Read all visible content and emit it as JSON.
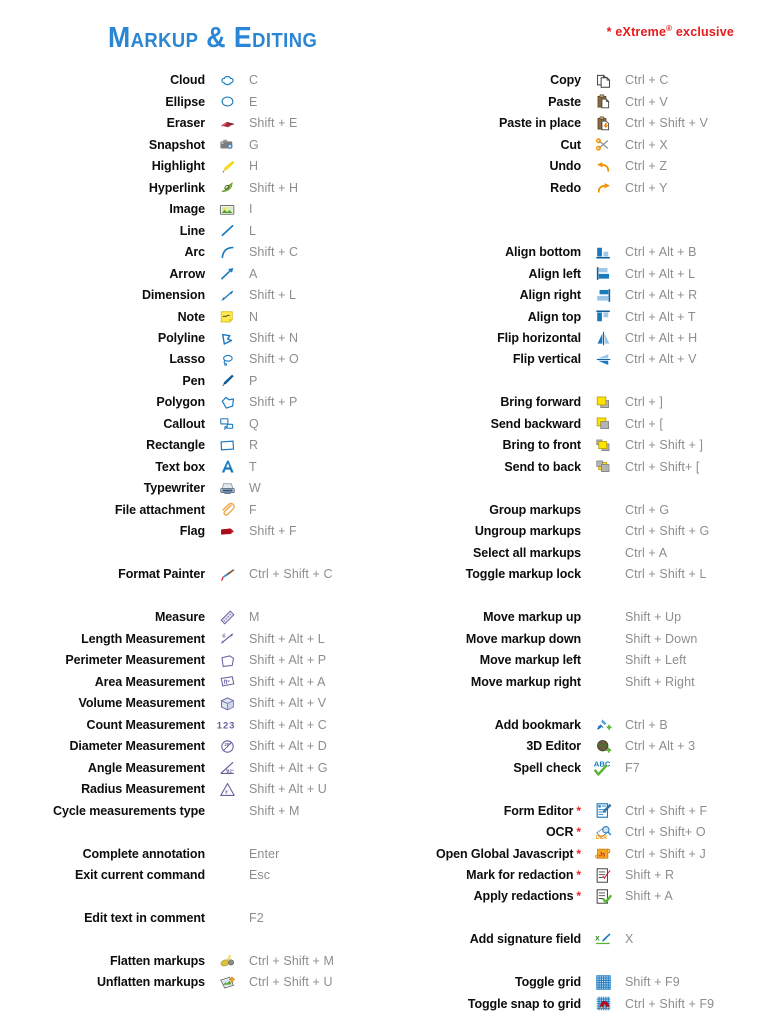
{
  "header": {
    "title": "Markup & Editing",
    "exclusive_note": "* eXtreme® exclusive",
    "colors": {
      "title_blue": "#2a86d4",
      "exclusive_red": "#e8191b",
      "label_black": "#0d0d0d",
      "shortcut_gray": "#8d8d8d",
      "measure_purple": "#6b5e9e",
      "markup_blue": "#1a7ac0",
      "page_background": "#ffffff"
    }
  },
  "left_column": [
    {
      "label": "Cloud",
      "icon": "cloud-icon",
      "shortcut": "C"
    },
    {
      "label": "Ellipse",
      "icon": "ellipse-icon",
      "shortcut": "E"
    },
    {
      "label": "Eraser",
      "icon": "eraser-icon",
      "shortcut": "Shift + E"
    },
    {
      "label": "Snapshot",
      "icon": "camera-icon",
      "shortcut": "G"
    },
    {
      "label": "Highlight",
      "icon": "highlighter-icon",
      "shortcut": "H"
    },
    {
      "label": "Hyperlink",
      "icon": "hyperlink-icon",
      "shortcut": "Shift + H"
    },
    {
      "label": "Image",
      "icon": "image-icon",
      "shortcut": "I"
    },
    {
      "label": "Line",
      "icon": "line-icon",
      "shortcut": "L"
    },
    {
      "label": "Arc",
      "icon": "arc-icon",
      "shortcut": "Shift + C"
    },
    {
      "label": "Arrow",
      "icon": "arrow-icon",
      "shortcut": "A"
    },
    {
      "label": "Dimension",
      "icon": "dimension-icon",
      "shortcut": "Shift + L"
    },
    {
      "label": "Note",
      "icon": "note-icon",
      "shortcut": "N"
    },
    {
      "label": "Polyline",
      "icon": "polyline-icon",
      "shortcut": "Shift + N"
    },
    {
      "label": "Lasso",
      "icon": "lasso-icon",
      "shortcut": "Shift + O"
    },
    {
      "label": "Pen",
      "icon": "pen-icon",
      "shortcut": "P"
    },
    {
      "label": "Polygon",
      "icon": "polygon-icon",
      "shortcut": "Shift + P"
    },
    {
      "label": "Callout",
      "icon": "callout-icon",
      "shortcut": "Q"
    },
    {
      "label": "Rectangle",
      "icon": "rectangle-icon",
      "shortcut": "R"
    },
    {
      "label": "Text box",
      "icon": "textbox-icon",
      "shortcut": "T"
    },
    {
      "label": "Typewriter",
      "icon": "typewriter-icon",
      "shortcut": "W"
    },
    {
      "label": "File attachment",
      "icon": "paperclip-icon",
      "shortcut": "F"
    },
    {
      "label": "Flag",
      "icon": "flag-icon",
      "shortcut": "Shift + F"
    },
    {
      "label": "",
      "icon": "",
      "shortcut": ""
    },
    {
      "label": "Format Painter",
      "icon": "format-painter-icon",
      "shortcut": "Ctrl + Shift + C"
    },
    {
      "label": "",
      "icon": "",
      "shortcut": ""
    },
    {
      "label": "Measure",
      "icon": "ruler-icon",
      "shortcut": "M"
    },
    {
      "label": "Length Measurement",
      "icon": "length-measurement-icon",
      "shortcut": "Shift + Alt + L"
    },
    {
      "label": "Perimeter Measurement",
      "icon": "perimeter-measurement-icon",
      "shortcut": "Shift + Alt + P"
    },
    {
      "label": "Area Measurement",
      "icon": "area-measurement-icon",
      "shortcut": "Shift + Alt + A"
    },
    {
      "label": "Volume Measurement",
      "icon": "volume-measurement-icon",
      "shortcut": "Shift + Alt + V"
    },
    {
      "label": "Count Measurement",
      "icon": "count-measurement-icon",
      "shortcut": "Shift + Alt + C"
    },
    {
      "label": "Diameter Measurement",
      "icon": "diameter-measurement-icon",
      "shortcut": "Shift + Alt + D"
    },
    {
      "label": "Angle Measurement",
      "icon": "angle-measurement-icon",
      "shortcut": "Shift + Alt + G"
    },
    {
      "label": "Radius Measurement",
      "icon": "radius-measurement-icon",
      "shortcut": "Shift + Alt + U"
    },
    {
      "label": "Cycle measurements type",
      "icon": "",
      "shortcut": "Shift + M"
    },
    {
      "label": "",
      "icon": "",
      "shortcut": ""
    },
    {
      "label": "Complete annotation",
      "icon": "",
      "shortcut": "Enter"
    },
    {
      "label": "Exit current command",
      "icon": "",
      "shortcut": "Esc"
    },
    {
      "label": "",
      "icon": "",
      "shortcut": ""
    },
    {
      "label": "Edit text in comment",
      "icon": "",
      "shortcut": "F2"
    },
    {
      "label": "",
      "icon": "",
      "shortcut": ""
    },
    {
      "label": "Flatten markups",
      "icon": "flatten-icon",
      "shortcut": "Ctrl + Shift + M"
    },
    {
      "label": "Unflatten markups",
      "icon": "unflatten-icon",
      "shortcut": "Ctrl + Shift + U"
    }
  ],
  "right_column": [
    {
      "label": "Copy",
      "icon": "copy-icon",
      "shortcut": "Ctrl + C",
      "exclusive": false
    },
    {
      "label": "Paste",
      "icon": "paste-icon",
      "shortcut": "Ctrl + V",
      "exclusive": false
    },
    {
      "label": "Paste in place",
      "icon": "paste-in-place-icon",
      "shortcut": "Ctrl + Shift + V",
      "exclusive": false
    },
    {
      "label": "Cut",
      "icon": "scissors-icon",
      "shortcut": "Ctrl + X",
      "exclusive": false
    },
    {
      "label": "Undo",
      "icon": "undo-icon",
      "shortcut": "Ctrl + Z",
      "exclusive": false
    },
    {
      "label": "Redo",
      "icon": "redo-icon",
      "shortcut": "Ctrl + Y",
      "exclusive": false
    },
    {
      "label": "",
      "icon": "",
      "shortcut": "",
      "exclusive": false
    },
    {
      "label": "",
      "icon": "",
      "shortcut": "",
      "exclusive": false
    },
    {
      "label": "Align bottom",
      "icon": "align-bottom-icon",
      "shortcut": "Ctrl + Alt + B",
      "exclusive": false
    },
    {
      "label": "Align left",
      "icon": "align-left-icon",
      "shortcut": "Ctrl + Alt + L",
      "exclusive": false
    },
    {
      "label": "Align right",
      "icon": "align-right-icon",
      "shortcut": "Ctrl + Alt + R",
      "exclusive": false
    },
    {
      "label": "Align top",
      "icon": "align-top-icon",
      "shortcut": "Ctrl + Alt + T",
      "exclusive": false
    },
    {
      "label": "Flip horizontal",
      "icon": "flip-horizontal-icon",
      "shortcut": "Ctrl + Alt + H",
      "exclusive": false
    },
    {
      "label": "Flip vertical",
      "icon": "flip-vertical-icon",
      "shortcut": "Ctrl + Alt + V",
      "exclusive": false
    },
    {
      "label": "",
      "icon": "",
      "shortcut": "",
      "exclusive": false
    },
    {
      "label": "Bring forward",
      "icon": "bring-forward-icon",
      "shortcut": "Ctrl + ]",
      "exclusive": false
    },
    {
      "label": "Send backward",
      "icon": "send-backward-icon",
      "shortcut": "Ctrl + [",
      "exclusive": false
    },
    {
      "label": "Bring to front",
      "icon": "bring-to-front-icon",
      "shortcut": "Ctrl + Shift + ]",
      "exclusive": false
    },
    {
      "label": "Send to back",
      "icon": "send-to-back-icon",
      "shortcut": "Ctrl + Shift+ [",
      "exclusive": false
    },
    {
      "label": "",
      "icon": "",
      "shortcut": "",
      "exclusive": false
    },
    {
      "label": "Group markups",
      "icon": "",
      "shortcut": "Ctrl + G",
      "exclusive": false
    },
    {
      "label": "Ungroup markups",
      "icon": "",
      "shortcut": "Ctrl + Shift + G",
      "exclusive": false
    },
    {
      "label": "Select all markups",
      "icon": "",
      "shortcut": "Ctrl + A",
      "exclusive": false
    },
    {
      "label": "Toggle markup lock",
      "icon": "",
      "shortcut": "Ctrl + Shift + L",
      "exclusive": false
    },
    {
      "label": "",
      "icon": "",
      "shortcut": "",
      "exclusive": false
    },
    {
      "label": "Move markup up",
      "icon": "",
      "shortcut": "Shift + Up",
      "exclusive": false
    },
    {
      "label": "Move markup down",
      "icon": "",
      "shortcut": "Shift + Down",
      "exclusive": false
    },
    {
      "label": "Move markup left",
      "icon": "",
      "shortcut": "Shift + Left",
      "exclusive": false
    },
    {
      "label": "Move markup right",
      "icon": "",
      "shortcut": "Shift + Right",
      "exclusive": false
    },
    {
      "label": "",
      "icon": "",
      "shortcut": "",
      "exclusive": false
    },
    {
      "label": "Add bookmark",
      "icon": "bookmark-icon",
      "shortcut": "Ctrl + B",
      "exclusive": false
    },
    {
      "label": "3D Editor",
      "icon": "3d-editor-icon",
      "shortcut": "Ctrl + Alt + 3",
      "exclusive": false
    },
    {
      "label": "Spell check",
      "icon": "spellcheck-icon",
      "shortcut": "F7",
      "exclusive": false
    },
    {
      "label": "",
      "icon": "",
      "shortcut": "",
      "exclusive": false
    },
    {
      "label": "Form Editor",
      "icon": "form-editor-icon",
      "shortcut": "Ctrl + Shift + F",
      "exclusive": true
    },
    {
      "label": "OCR",
      "icon": "ocr-icon",
      "shortcut": "Ctrl  + Shift+ O",
      "exclusive": true
    },
    {
      "label": "Open Global Javascript",
      "icon": "javascript-icon",
      "shortcut": "Ctrl  + Shift + J",
      "exclusive": true
    },
    {
      "label": "Mark for redaction",
      "icon": "mark-redaction-icon",
      "shortcut": "Shift + R",
      "exclusive": true
    },
    {
      "label": "Apply redactions",
      "icon": "apply-redactions-icon",
      "shortcut": "Shift + A",
      "exclusive": true
    },
    {
      "label": "",
      "icon": "",
      "shortcut": "",
      "exclusive": false
    },
    {
      "label": "Add signature field",
      "icon": "signature-icon",
      "shortcut": "X",
      "exclusive": false
    },
    {
      "label": "",
      "icon": "",
      "shortcut": "",
      "exclusive": false
    },
    {
      "label": "Toggle grid",
      "icon": "grid-icon",
      "shortcut": "Shift + F9",
      "exclusive": false
    },
    {
      "label": "Toggle snap to grid",
      "icon": "snap-to-grid-icon",
      "shortcut": "Ctrl + Shift + F9",
      "exclusive": false
    }
  ]
}
